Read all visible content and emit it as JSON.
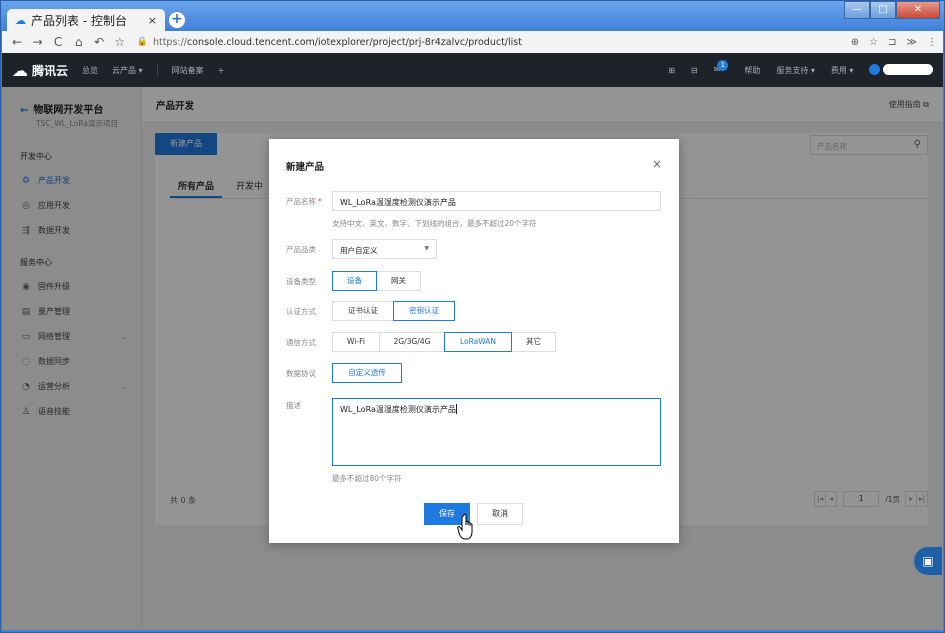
{
  "browser": {
    "tab_title": "产品列表 - 控制台",
    "tab_icon": "cloud-icon",
    "tab_close": "×",
    "new_tab": "+",
    "window_controls": {
      "minimize": "—",
      "maximize": "□",
      "close": "✕"
    },
    "nav": {
      "back": "←",
      "forward": "→",
      "reload": "C",
      "home": "⌂",
      "undo": "↶",
      "bookmark": "☆"
    },
    "url_protocol": "https://",
    "url_rest": "console.cloud.tencent.com/iotexplorer/project/prj-8r4zalvc/product/list",
    "addr_right": [
      "⊕",
      "☆",
      "⊐",
      "≫",
      "⋮"
    ]
  },
  "topnav": {
    "brand": "腾讯云",
    "items": [
      "总览",
      "云产品 ▾"
    ],
    "record": "网站备案",
    "plus": "+",
    "right": {
      "icon1": "⊞",
      "icon2": "⊟",
      "mail": "✉",
      "mail_badge": "1",
      "help": "帮助",
      "support": "服务支持 ▾",
      "cost": "费用 ▾"
    }
  },
  "sidebar": {
    "title": "物联网开发平台",
    "back": "←",
    "subtitle": "TSC_WL_LoRa演示项目",
    "group1": "开发中心",
    "group1_items": [
      {
        "label": "产品开发",
        "icon": "⚙",
        "active": true
      },
      {
        "label": "应用开发",
        "icon": "◎"
      },
      {
        "label": "数据开发",
        "icon": "⇶"
      }
    ],
    "group2": "服务中心",
    "group2_items": [
      {
        "label": "固件升级",
        "icon": "◉"
      },
      {
        "label": "量产管理",
        "icon": "▤"
      },
      {
        "label": "网络管理",
        "icon": "▭",
        "chevron": "⌄"
      },
      {
        "label": "数据同步",
        "icon": "◌"
      },
      {
        "label": "运营分析",
        "icon": "◔",
        "chevron": "⌄"
      },
      {
        "label": "语音技能",
        "icon": "♙"
      }
    ]
  },
  "main": {
    "page_title": "产品开发",
    "guide": "使用指南 ⧉",
    "new_button": "新建产品",
    "search_placeholder": "产品名称",
    "search_icon": "⚲",
    "tabs": [
      "所有产品",
      "开发中"
    ],
    "total": "共 0 条",
    "pager": {
      "first": "|◂",
      "prev": "◂",
      "page": "1",
      "total_pages": "/1页",
      "next": "▸",
      "last": "▸|"
    }
  },
  "modal": {
    "title": "新建产品",
    "close": "×",
    "name_label": "产品名称",
    "required_mark": "*",
    "name_value": "WL_LoRa温湿度检测仪演示产品",
    "name_hint": "支持中文、英文、数字、下划线的组合，最多不超过20个字符",
    "category_label": "产品品类",
    "category_value": "用户自定义",
    "category_arrow": "▼",
    "device_type_label": "设备类型",
    "device_types": [
      "设备",
      "网关"
    ],
    "auth_label": "认证方式",
    "auth_options": [
      "证书认证",
      "密钥认证"
    ],
    "comm_label": "通信方式",
    "comm_options": [
      "Wi-Fi",
      "2G/3G/4G",
      "LoRaWAN",
      "其它"
    ],
    "protocol_label": "数据协议",
    "protocol_value": "自定义透传",
    "desc_label": "描述",
    "desc_value": "WL_LoRa温湿度检测仪演示产品",
    "desc_hint": "最多不超过80个字符",
    "save": "保存",
    "cancel": "取消"
  },
  "colors": {
    "accent": "#1f7ae0",
    "topnav_bg": "#1e2329",
    "required": "#e54545"
  }
}
